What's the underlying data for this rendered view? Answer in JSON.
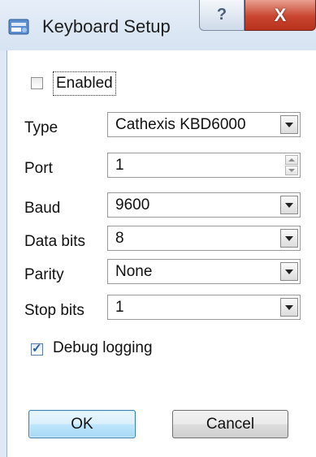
{
  "window": {
    "title": "Keyboard Setup",
    "help_glyph": "?",
    "close_glyph": "X",
    "icon": "keyboard-app-icon"
  },
  "form": {
    "enabled": {
      "label": "Enabled",
      "checked": false
    },
    "type": {
      "label": "Type",
      "value": "Cathexis KBD6000"
    },
    "port": {
      "label": "Port",
      "value": "1"
    },
    "baud": {
      "label": "Baud",
      "value": "9600"
    },
    "data_bits": {
      "label": "Data bits",
      "value": "8"
    },
    "parity": {
      "label": "Parity",
      "value": "None"
    },
    "stop_bits": {
      "label": "Stop bits",
      "value": "1"
    },
    "debug_logging": {
      "label": "Debug logging",
      "checked": true
    }
  },
  "buttons": {
    "ok": "OK",
    "cancel": "Cancel"
  },
  "colors": {
    "close_red": "#c9452f",
    "ok_blue": "#3c7fb1",
    "frame": "#dfe9f5"
  }
}
